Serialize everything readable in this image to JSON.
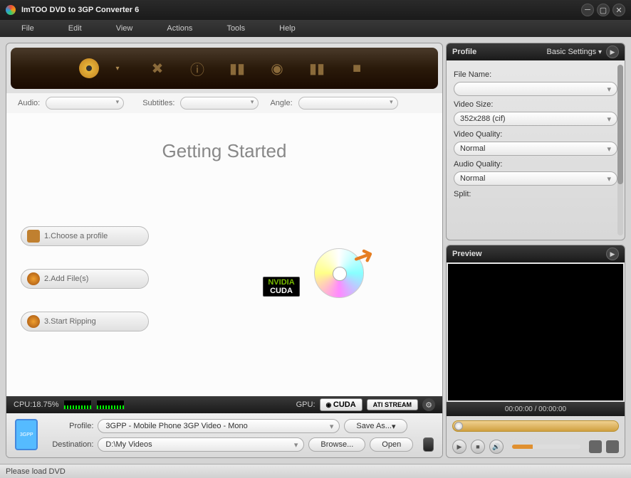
{
  "titlebar": {
    "title": "ImTOO DVD to 3GP Converter 6"
  },
  "menu": {
    "file": "File",
    "edit": "Edit",
    "view": "View",
    "actions": "Actions",
    "tools": "Tools",
    "help": "Help"
  },
  "filters": {
    "audio": "Audio:",
    "subtitles": "Subtitles:",
    "angle": "Angle:"
  },
  "main": {
    "heading": "Getting Started",
    "steps": {
      "s1": "1.Choose a profile",
      "s2": "2.Add File(s)",
      "s3": "3.Start Ripping"
    },
    "nvidia": {
      "brand": "NVIDIA",
      "cuda": "CUDA"
    }
  },
  "cpubar": {
    "cpu": "CPU:18.75%",
    "gpu": "GPU:",
    "cuda": "CUDA",
    "ati": "ATI STREAM"
  },
  "bottom": {
    "profile_label": "Profile:",
    "profile_value": "3GPP - Mobile Phone 3GP Video - Mono",
    "saveas": "Save As...",
    "dest_label": "Destination:",
    "dest_value": "D:\\My Videos",
    "browse": "Browse...",
    "open": "Open"
  },
  "profile_panel": {
    "title": "Profile",
    "settings": "Basic Settings",
    "fields": {
      "filename_lbl": "File Name:",
      "filename_val": "",
      "vsize_lbl": "Video Size:",
      "vsize_val": "352x288 (cif)",
      "vqual_lbl": "Video Quality:",
      "vqual_val": "Normal",
      "aqual_lbl": "Audio Quality:",
      "aqual_val": "Normal",
      "split_lbl": "Split:"
    }
  },
  "preview": {
    "title": "Preview",
    "timecode": "00:00:00 / 00:00:00"
  },
  "status": {
    "text": "Please load DVD"
  }
}
